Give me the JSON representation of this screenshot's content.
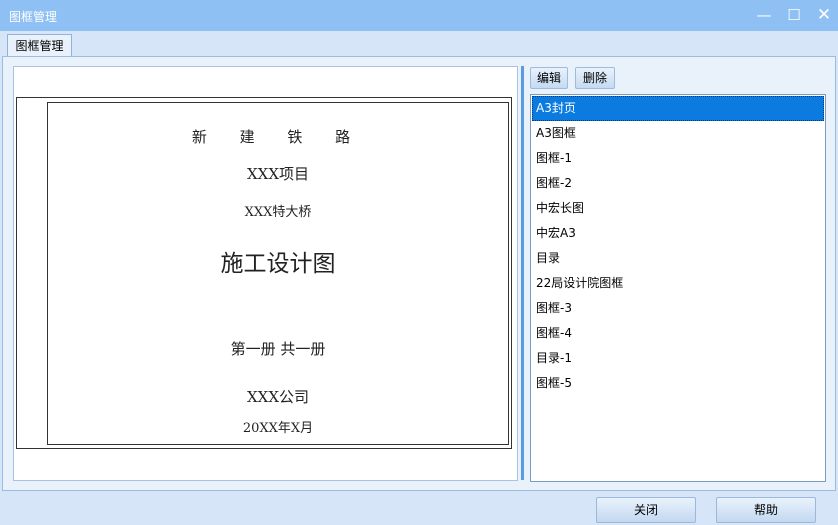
{
  "window": {
    "title": "图框管理",
    "minimize_glyph": "—",
    "maximize_glyph": "☐",
    "close_glyph": "✕"
  },
  "tab": {
    "label": "图框管理"
  },
  "preview": {
    "line1": "新 建 铁 路",
    "line2": "XXX项目",
    "line3": "XXX特大桥",
    "line4": "施工设计图",
    "line5": "第一册 共一册",
    "line6": "XXX公司",
    "line7": "20XX年X月"
  },
  "toolbar": {
    "edit_label": "编辑",
    "delete_label": "删除"
  },
  "frame_list": {
    "selected_index": 0,
    "items": [
      "A3封页",
      "A3图框",
      "图框-1",
      "图框-2",
      "中宏长图",
      "中宏A3",
      "目录",
      "22局设计院图框",
      "图框-3",
      "图框-4",
      "目录-1",
      "图框-5"
    ]
  },
  "footer": {
    "close_label": "关闭",
    "help_label": "帮助"
  }
}
